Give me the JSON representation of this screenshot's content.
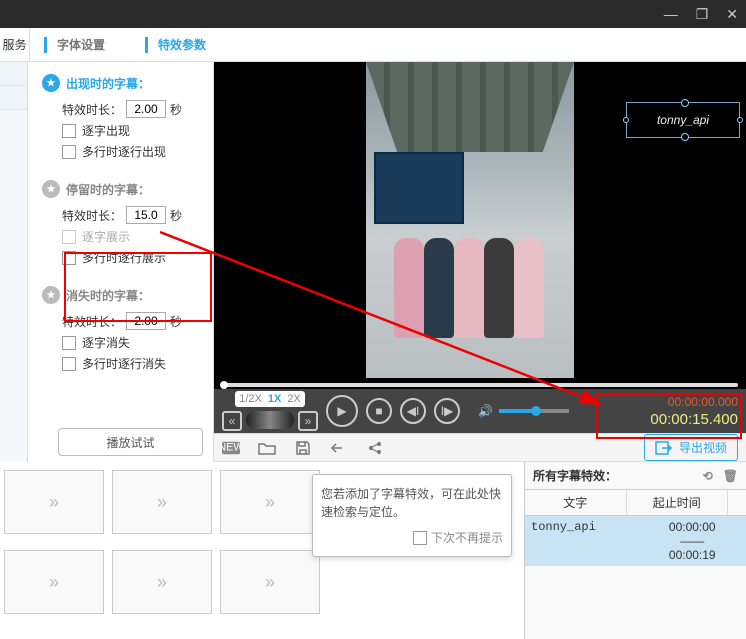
{
  "titlebar": {
    "min_icon": "—",
    "max_icon": "❐",
    "close_icon": "✕"
  },
  "svc_label": "服务",
  "tabs": {
    "font_settings": "字体设置",
    "effect_params": "特效参数"
  },
  "appear": {
    "title": "出现时的字幕：",
    "duration_label": "特效时长：",
    "duration_value": "2.00",
    "sec": "秒",
    "chk1": "逐字出现",
    "chk2": "多行时逐行出现"
  },
  "stay": {
    "title": "停留时的字幕：",
    "duration_label": "特效时长：",
    "duration_value": "15.0",
    "sec": "秒",
    "chk1": "逐字展示",
    "chk2": "多行时逐行展示"
  },
  "disappear": {
    "title": "消失时的字幕：",
    "duration_label": "特效时长：",
    "duration_value": "2.00",
    "sec": "秒",
    "chk1": "逐字消失",
    "chk2": "多行时逐行消失"
  },
  "play_test": "播放试试",
  "watermark": "tonny_api",
  "speed": {
    "half": "1/2X",
    "one": "1X",
    "two": "2X"
  },
  "time": {
    "t1": "00:00:00.000",
    "t2": "00:00:15.400"
  },
  "export_label": "导出视频",
  "tip": {
    "text": "您若添加了字幕特效，可在此处快速检索与定位。",
    "dont_show": "下次不再提示"
  },
  "fx": {
    "header": "所有字幕特效：",
    "col_text": "文字",
    "col_time": "起止时间",
    "row_text": "tonny_api",
    "row_t1": "00:00:00",
    "row_sep": "——",
    "row_t2": "00:00:19"
  },
  "toolbar_icons": {
    "new": "NEW"
  }
}
